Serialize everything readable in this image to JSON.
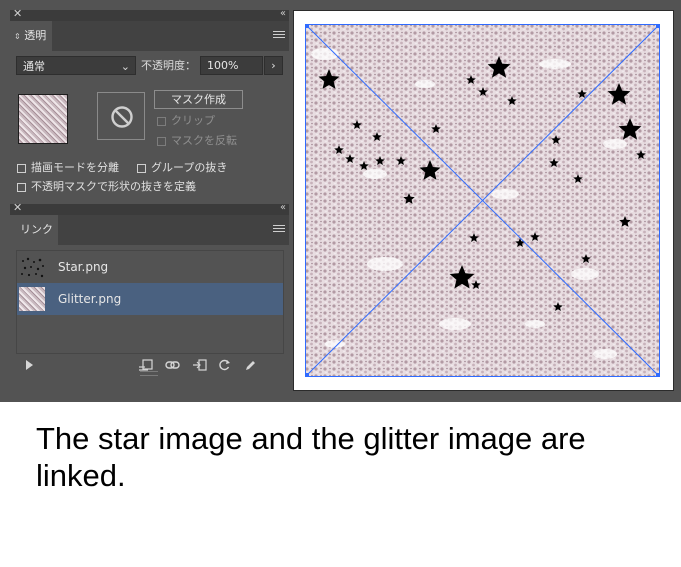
{
  "transparency_panel": {
    "tab_label": "透明",
    "blend_mode": "通常",
    "opacity_label": "不透明度：",
    "opacity_value": "100%",
    "make_mask_label": "マスク作成",
    "clip_label": "クリップ",
    "invert_mask_label": "マスクを反転",
    "isolate_blending_label": "描画モードを分離",
    "knockout_group_label": "グループの抜き",
    "opacity_mask_knockout_label": "不透明マスクで形状の抜きを定義"
  },
  "links_panel": {
    "tab_label": "リンク",
    "items": [
      {
        "name": "Star.png",
        "selected": false
      },
      {
        "name": "Glitter.png",
        "selected": true
      }
    ],
    "toolbar_icons": [
      "show-list-icon",
      "relink-from-cc-icon",
      "relink-icon",
      "go-to-link-icon",
      "update-link-icon",
      "edit-original-icon"
    ]
  },
  "caption": "The star image and the glitter image are linked.",
  "colors": {
    "panel_bg": "#535353",
    "selection": "#4a6180",
    "bounding_box": "#2f6bff",
    "glitter": "#b9a0aa"
  }
}
